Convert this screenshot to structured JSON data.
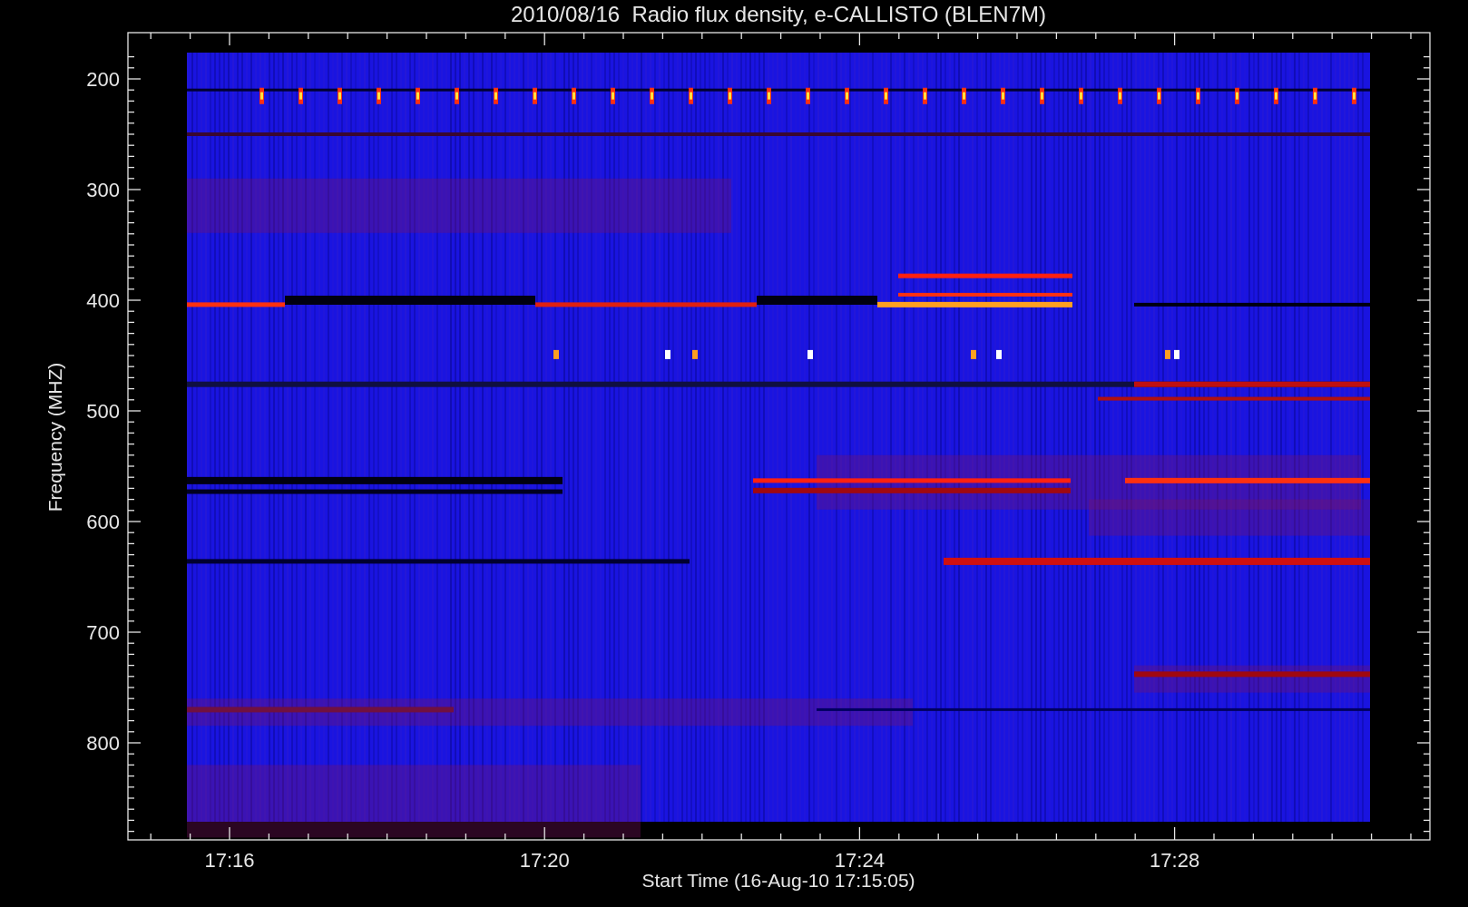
{
  "title": "2010/08/16  Radio flux density, e-CALLISTO (BLEN7M)",
  "y_axis": {
    "label": "Frequency (MHZ)",
    "ticks": [
      "200",
      "300",
      "400",
      "500",
      "600",
      "700",
      "800"
    ]
  },
  "x_axis": {
    "label": "Start Time (16-Aug-10 17:15:05)",
    "ticks": [
      "17:16",
      "17:20",
      "17:24",
      "17:28"
    ]
  }
}
